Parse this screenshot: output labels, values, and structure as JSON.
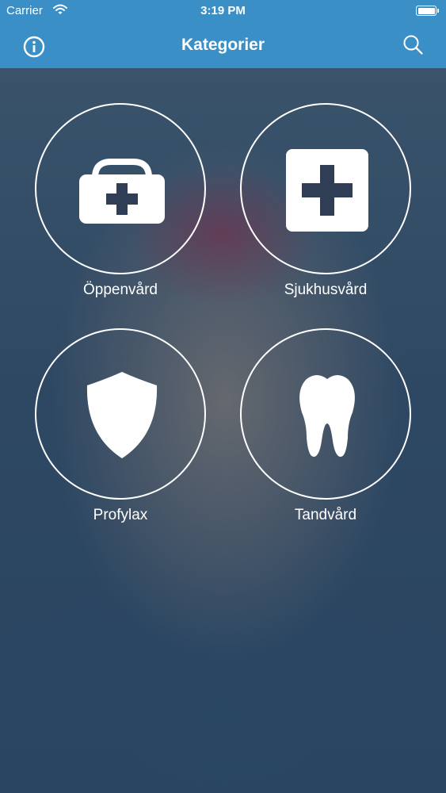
{
  "status_bar": {
    "carrier": "Carrier",
    "time": "3:19 PM",
    "wifi_icon": "wifi-icon",
    "battery_icon": "battery-icon"
  },
  "nav": {
    "title": "Kategorier",
    "left_icon": "info-icon",
    "right_icon": "search-icon"
  },
  "categories": [
    {
      "label": "Öppenvård",
      "icon": "medical-bag-icon"
    },
    {
      "label": "Sjukhusvård",
      "icon": "hospital-cross-icon"
    },
    {
      "label": "Profylax",
      "icon": "shield-icon"
    },
    {
      "label": "Tandvård",
      "icon": "tooth-icon"
    }
  ],
  "colors": {
    "nav_background": "#3a8fc6",
    "background": "#29415a",
    "icon_cutout": "#2f3e55"
  }
}
